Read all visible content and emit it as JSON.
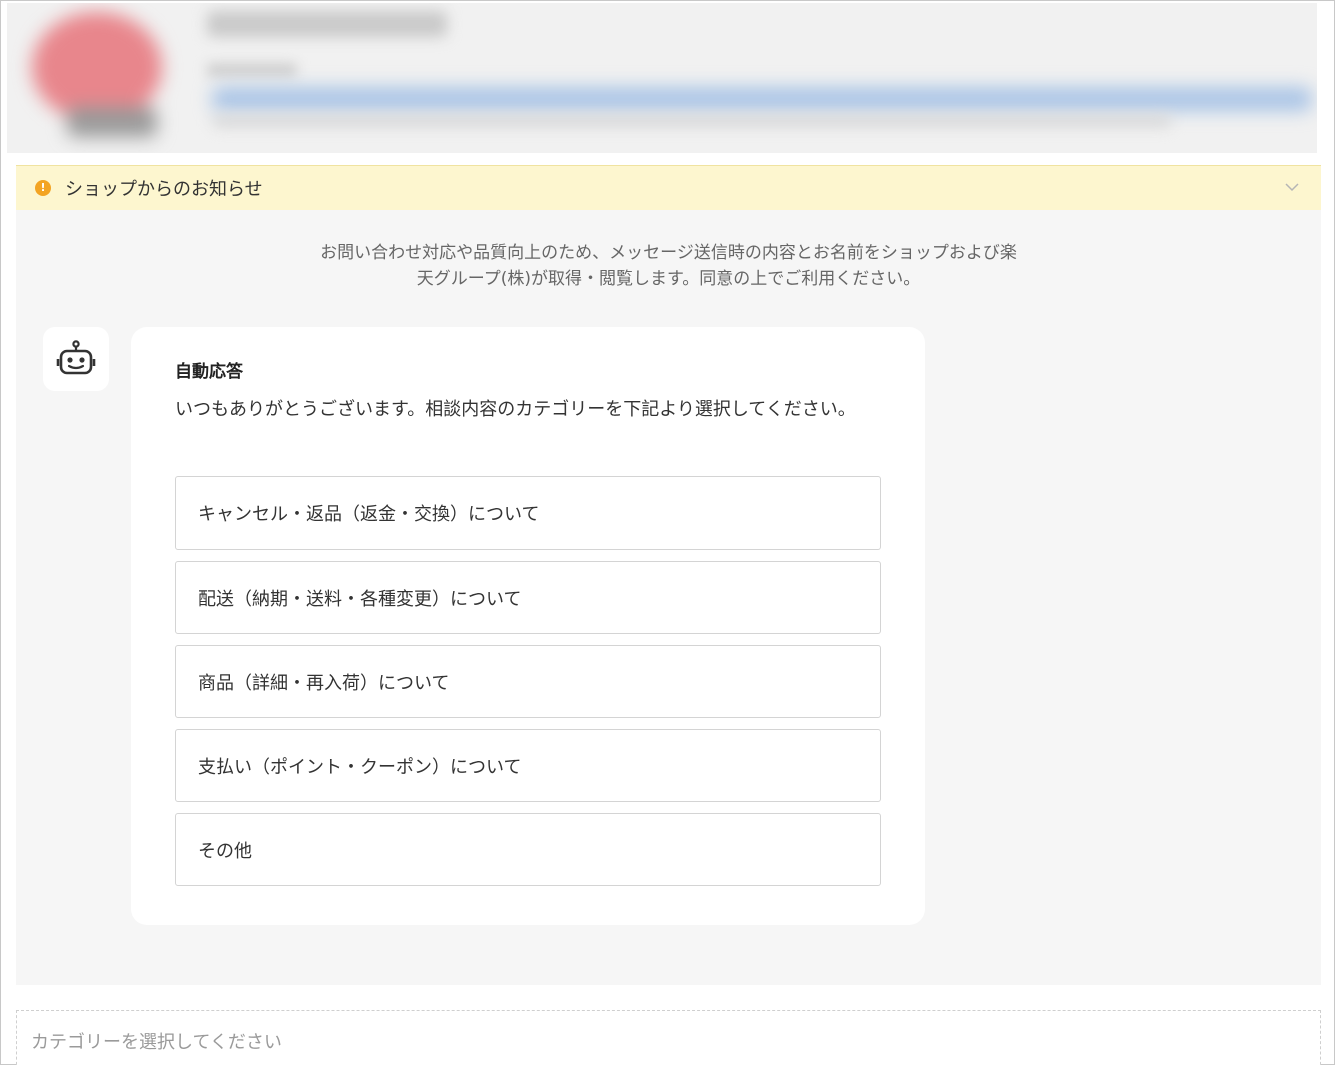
{
  "notice": {
    "icon": "info-icon",
    "icon_glyph": "!",
    "title": "ショップからのお知らせ",
    "toggle_icon": "chevron-down-icon"
  },
  "consent": {
    "line1": "お問い合わせ対応や品質向上のため、メッセージ送信時の内容とお名前をショップおよび楽",
    "line2": "天グループ(株)が取得・閲覧します。同意の上でご利用ください。"
  },
  "bot": {
    "avatar_icon": "robot-icon",
    "title": "自動応答",
    "message": "いつもありがとうございます。相談内容のカテゴリーを下記より選択してください。",
    "options": [
      "キャンセル・返品（返金・交換）について",
      "配送（納期・送料・各種変更）について",
      "商品（詳細・再入荷）について",
      "支払い（ポイント・クーポン）について",
      "その他"
    ]
  },
  "input": {
    "placeholder": "カテゴリーを選択してください",
    "value": ""
  },
  "colors": {
    "notice_bg": "#fdf6cf",
    "notice_icon": "#f3a423",
    "chat_bg": "#f6f6f6",
    "option_border": "#d4d4d4"
  }
}
